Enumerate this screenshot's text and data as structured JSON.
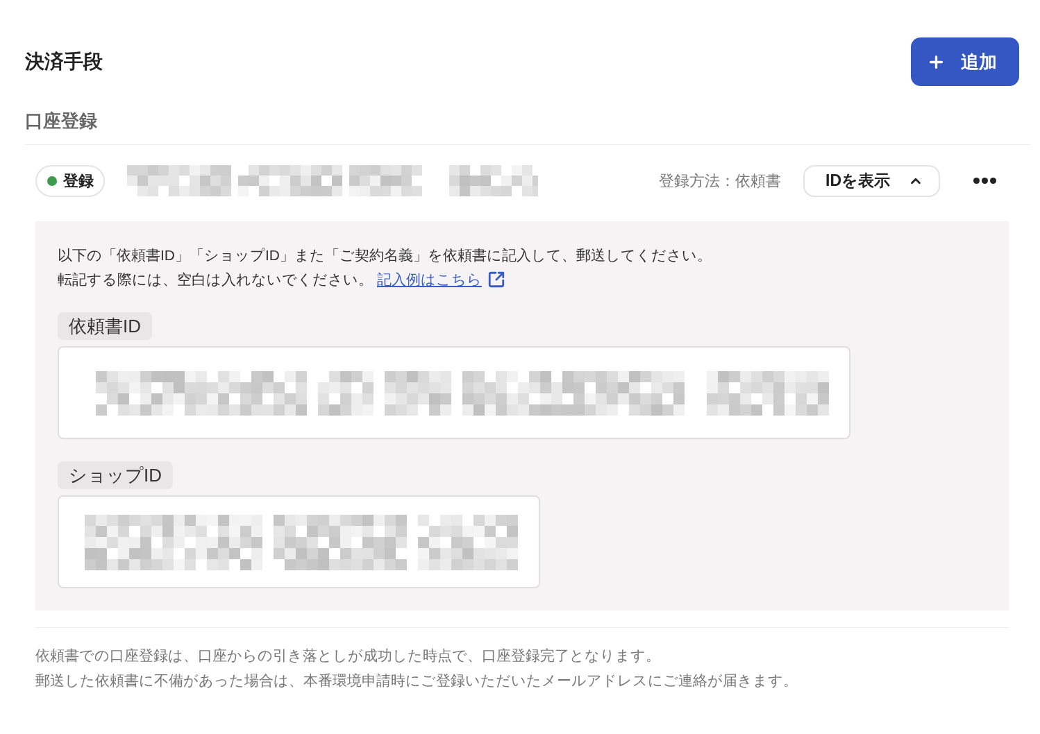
{
  "header": {
    "title": "決済手段",
    "add_button": {
      "label": "追加"
    }
  },
  "section": {
    "title": "口座登録"
  },
  "account": {
    "status": {
      "label": "登録"
    },
    "method": "登録方法：依頼書",
    "toggle_button": {
      "label": "IDを表示",
      "expanded": true
    }
  },
  "details": {
    "instructions": [
      "以下の「依頼書ID」「ショップID」また「ご契約名義」を依頼書に記入して、郵送してください。",
      "転記する際には、空白は入れないでください。"
    ],
    "link": "記入例はこちら",
    "fields": [
      {
        "label": "依頼書ID"
      },
      {
        "label": "ショップID"
      }
    ]
  },
  "notes": [
    "依頼書での口座登録は、口座からの引き落としが成功した時点で、口座登録完了となります。",
    "郵送した依頼書に不備があった場合は、本番環境申請時にご登録いただいたメールアドレスにご連絡が届きます。"
  ]
}
